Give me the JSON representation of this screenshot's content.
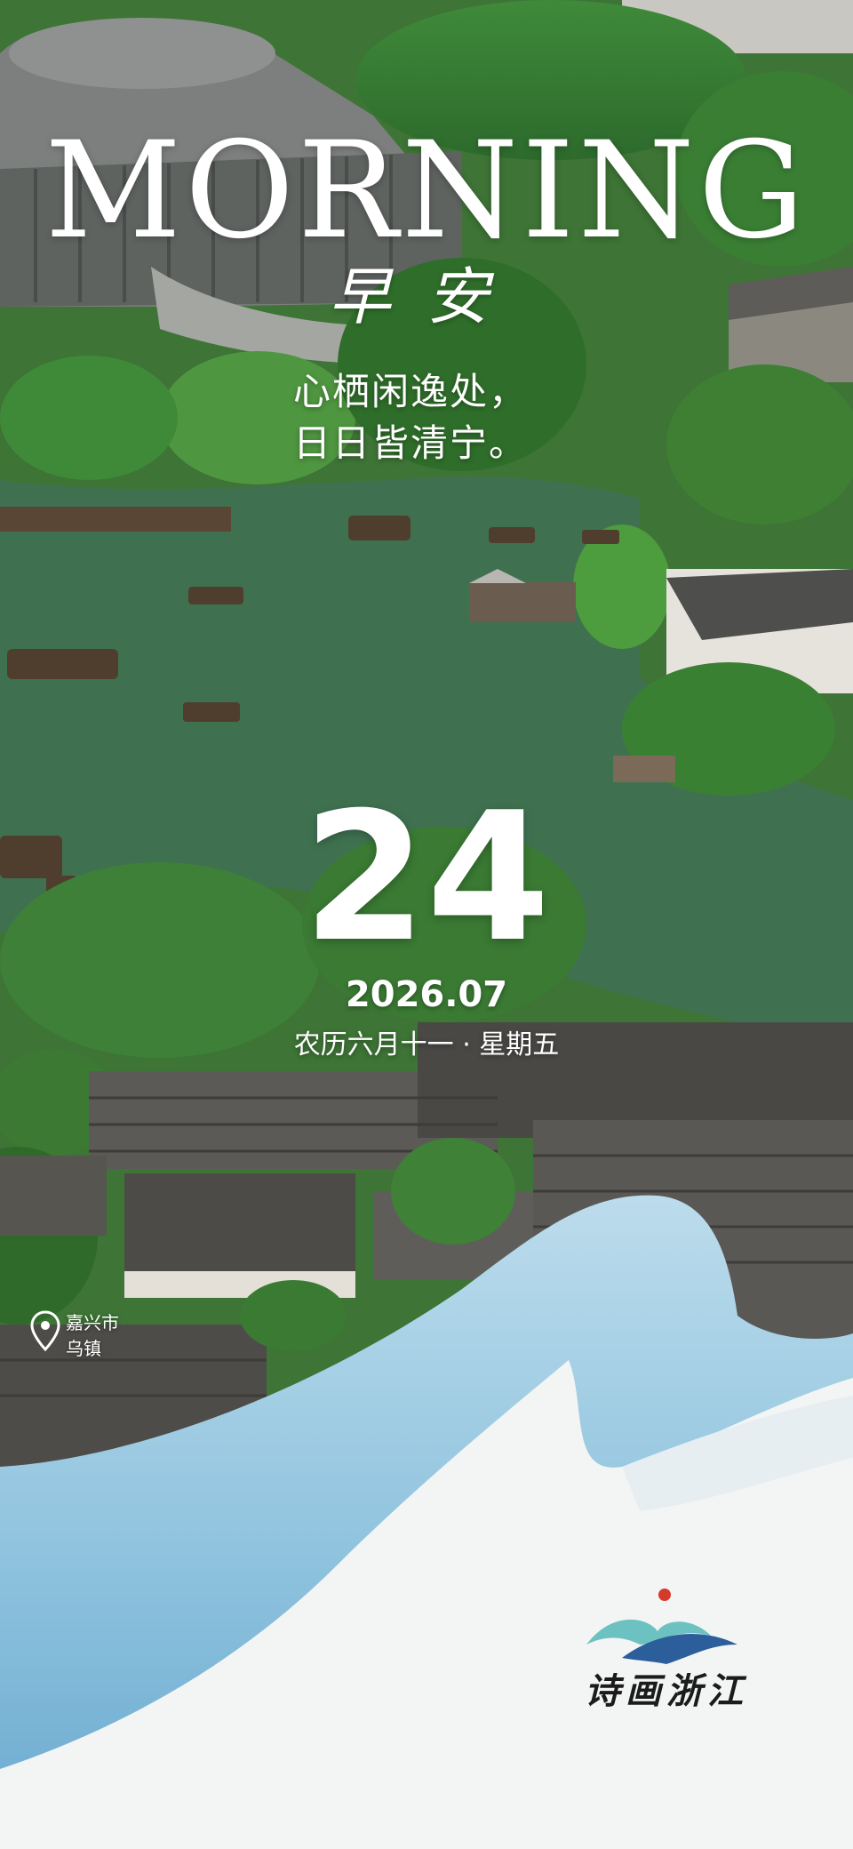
{
  "headline": {
    "english": "MORNING",
    "chinese": "早安"
  },
  "poem": {
    "line1": "心栖闲逸处，",
    "line2": "日日皆清宁。"
  },
  "date": {
    "day": "24",
    "year_month": "2026.07",
    "lunar_weekday": "农历六月十一 · 星期五"
  },
  "location": {
    "icon": "location-pin-icon",
    "city": "嘉兴市",
    "town": "乌镇"
  },
  "brand": {
    "name": "诗画浙江",
    "colors": {
      "red": "#d63a2c",
      "teal": "#6cc2c0",
      "blue": "#2d5e9c"
    }
  }
}
